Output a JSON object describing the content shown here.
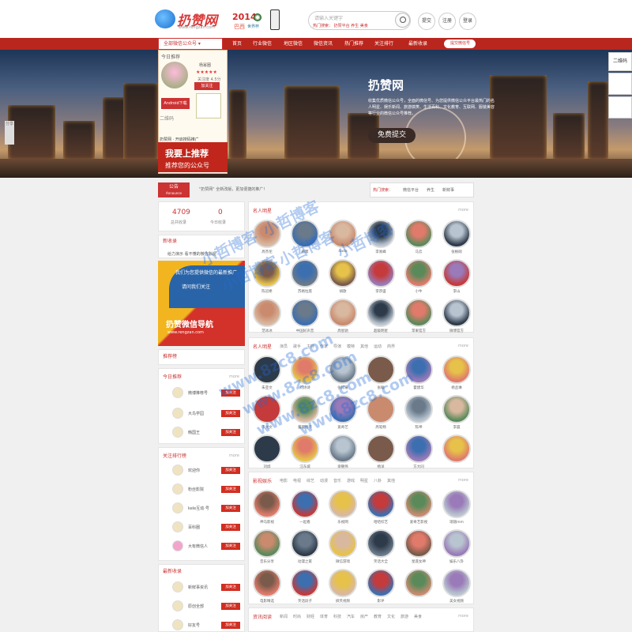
{
  "header": {
    "logo_text": "扔赞网",
    "logo_sub": "www.rengzan.com",
    "wc_year": "2014",
    "wc_country": "巴西",
    "wc_cup": "世界杯",
    "phone_label": "手机关注",
    "search_placeholder": "请输入关键字",
    "search_hot": "热门搜索：  扔赞平台  养生  美食",
    "actions": [
      "提交",
      "注册",
      "登录"
    ]
  },
  "nav": {
    "category_label": "全部微信公众号",
    "items": [
      "首页",
      "行业微信",
      "地区微信",
      "微信资讯",
      "热门推荐",
      "关注排行",
      "最新收录"
    ],
    "pill": "提交微信号"
  },
  "banner": {
    "title": "扔赞网",
    "desc": "收集优质微信公众号，全面的微信号、为您提供微信公众平台最热门的名人明星、娱乐新闻、旅游搞笑、生活百科、文化教育、互联网、服装美容等行业的微信公众号推荐。",
    "button": "免费提交",
    "dots": 5
  },
  "floatcard": {
    "today": "今日推荐",
    "name": "杨幂圈",
    "stars": "★★★★★",
    "meta": "关注度 4.5分",
    "follow": "加关注",
    "android": "Android下载",
    "code_label": "二维码",
    "bottom": "扔赞网 ·  开启搜码推广",
    "red_title": "我要上推荐",
    "red_sub": "推荐您的公众号"
  },
  "side": {
    "qr": "二维码",
    "share": "分享"
  },
  "notice": {
    "title": "公告",
    "sub": "Announce",
    "text": "\"扔赞网\" 全新改版，更加便捷的推广！",
    "tag_label": "热门搜索：",
    "tags": [
      "微信平台",
      "养生",
      "新鲜事"
    ]
  },
  "stats": {
    "total": "4709",
    "total_label": "总共收录",
    "today": "0",
    "today_label": "今日收录"
  },
  "left": {
    "panel1_title": "新收录",
    "panel1_text": "给力演示 看不懂的微信影视",
    "ad_line1": "我们为您提供微信的最新推广",
    "ad_line2": "请问我们关注",
    "ad_title": "扔赞微信导航",
    "ad_url": "www.rengzan.com",
    "panel2_title": "推荐榜",
    "today_title": "今日推荐",
    "today_items": [
      "微博推荐号",
      "大鸟学园",
      "韩国王"
    ],
    "rank_title": "关注排行榜",
    "rank_items": [
      "欢迎你",
      "粉丝影院",
      "kele互动·号",
      "百科圈",
      "大有微信人"
    ],
    "latest_title": "最新收录",
    "latest_items": [
      "新鲜事资讯",
      "原创全部",
      "好友号"
    ],
    "follow_label": "加关注",
    "more": "more"
  },
  "sections": [
    {
      "title": "名人明星",
      "tabs": [],
      "names": [
        "周杰伦",
        "杨幂",
        "dada",
        "李易峰",
        "马云",
        "张根硕",
        "陈冠希",
        "苏格拉底",
        "胡歌",
        "李宗盛",
        "小牛",
        "李山",
        "范冰冰",
        "中国好声音",
        "周星驰",
        "超级明星",
        "苹果官方",
        "微博官方"
      ]
    },
    {
      "title": "名人明星",
      "tabs": [
        "演员",
        "歌手",
        "主持",
        "作家",
        "导演",
        "模特",
        "其他",
        "运动",
        "商界"
      ],
      "names": [
        "朱亚文",
        "刘诗诗",
        "张钧甯",
        "张翰",
        "霍建华",
        "杨丞琳",
        "于文文",
        "董璇杨子",
        "爱奇艺",
        "周笔畅",
        "陈坤",
        "李晨",
        "刘烨",
        "汪东城",
        "梁朝伟",
        "杨洋",
        "方大同",
        ""
      ]
    },
    {
      "title": "影视娱乐",
      "tabs": [
        "电影",
        "电视",
        "综艺",
        "动漫",
        "音乐",
        "游戏",
        "明星",
        "八卦",
        "其他"
      ],
      "names": [
        "神马影视",
        "一起看",
        "乐视网",
        "哈哈综艺",
        "爱奇艺影视",
        "瑞丽mm",
        "音乐分享",
        "动漫之家",
        "微信游戏",
        "笑话大全",
        "星座女神",
        "娱乐八卦",
        "电影精选",
        "笑话段子",
        "搞笑视频",
        "影评",
        "",
        "美女视频"
      ]
    },
    {
      "title": "资讯阅读",
      "tabs": [
        "新闻",
        "时尚",
        "财经",
        "体育",
        "科技",
        "汽车",
        "房产",
        "教育",
        "文化",
        "旅游",
        "美食"
      ],
      "names": []
    }
  ],
  "watermarks": [
    "小哲博客",
    "小哲博客",
    "小哲博客",
    "小哲博客",
    "小哲博客",
    "www.8zc8.com",
    "www.8zc8.com",
    "www.8zc8.com",
    "www.8zc8.com"
  ]
}
